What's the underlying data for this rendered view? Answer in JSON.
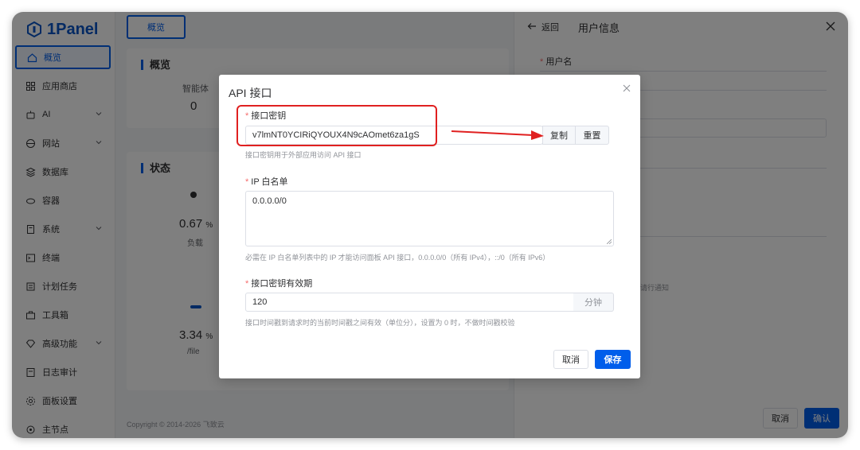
{
  "app": {
    "logo_text": "1Panel"
  },
  "sidebar": {
    "items": [
      {
        "label": "概览",
        "icon": "home-icon",
        "active": true
      },
      {
        "label": "应用商店",
        "icon": "store-icon"
      },
      {
        "label": "AI",
        "icon": "robot-icon",
        "has_children": true
      },
      {
        "label": "网站",
        "icon": "globe-icon",
        "has_children": true
      },
      {
        "label": "数据库",
        "icon": "database-icon"
      },
      {
        "label": "容器",
        "icon": "container-icon"
      },
      {
        "label": "系统",
        "icon": "system-icon",
        "has_children": true
      },
      {
        "label": "终端",
        "icon": "terminal-icon"
      },
      {
        "label": "计划任务",
        "icon": "calendar-icon"
      },
      {
        "label": "工具箱",
        "icon": "toolbox-icon"
      },
      {
        "label": "高级功能",
        "icon": "diamond-icon",
        "has_children": true
      },
      {
        "label": "日志审计",
        "icon": "log-icon"
      },
      {
        "label": "面板设置",
        "icon": "settings-icon"
      },
      {
        "label": "主节点",
        "icon": "node-icon"
      }
    ]
  },
  "main": {
    "tab": "概览",
    "overview_title": "概览",
    "agent_label": "智能体",
    "agent_count": "0",
    "status_title": "状态",
    "load_value": "0.67",
    "load_unit": "%",
    "load_label": "负载",
    "disk_value": "3.34",
    "disk_unit": "%",
    "disk_label": "/file",
    "copyright": "Copyright © 2014-2026 飞致云"
  },
  "drawer": {
    "back_label": "返回",
    "title": "用户信息",
    "username_label": "用户名",
    "hint_text": "请行通知",
    "cancel_label": "取消",
    "confirm_label": "确认"
  },
  "dialog": {
    "title": "API 接口",
    "api_key": {
      "label": "接口密钥",
      "value": "v7lmNT0YCIRiQYOUX4N9cAOmet6za1gS",
      "copy_label": "复制",
      "reset_label": "重置",
      "hint": "接口密钥用于外部应用访问 API 接口"
    },
    "ip_whitelist": {
      "label": "IP 白名单",
      "value": "0.0.0.0/0",
      "hint": "必需在 IP 白名单列表中的 IP 才能访问面板 API 接口，0.0.0.0/0（所有 IPv4），::/0（所有 IPv6）"
    },
    "validity": {
      "label": "接口密钥有效期",
      "value": "120",
      "unit": "分钟",
      "hint": "接口时间戳到请求时的当前时间戳之间有效（单位分），设置为 0 时，不做时间戳校验"
    },
    "cancel_label": "取消",
    "save_label": "保存"
  },
  "colors": {
    "primary": "#005eeb",
    "required": "#f56c6c",
    "annotation": "#e02020"
  }
}
